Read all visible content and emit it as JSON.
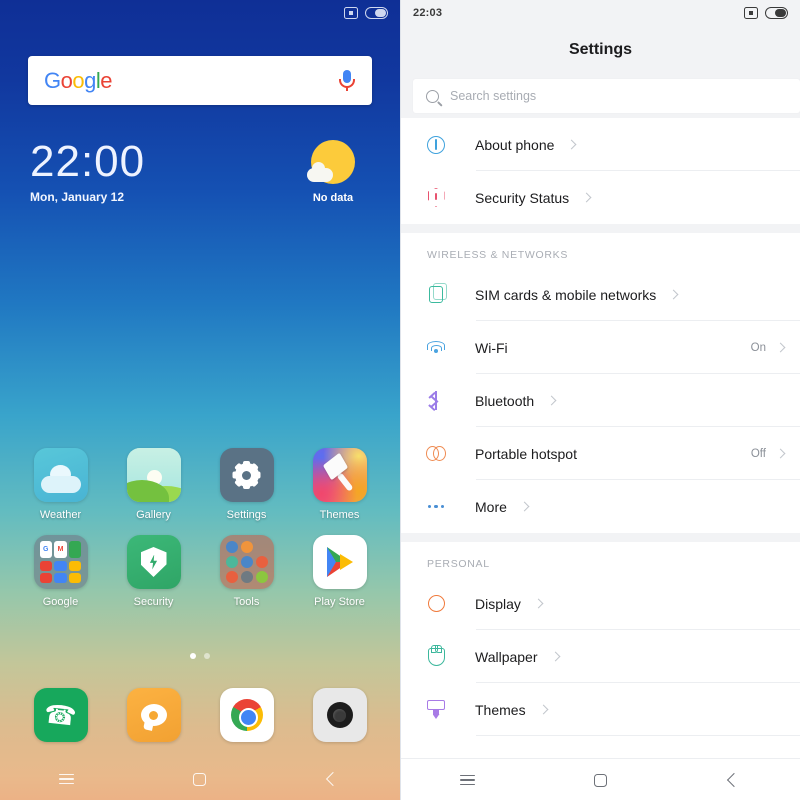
{
  "home": {
    "status_bar": {
      "icons": [
        "screenshot-icon",
        "battery-icon"
      ]
    },
    "google_search": {
      "logo_letters": [
        "G",
        "o",
        "o",
        "g",
        "l",
        "e"
      ],
      "mic_icon": "microphone-icon"
    },
    "clock_widget": {
      "time": "22:00",
      "date": "Mon, January 12"
    },
    "weather_widget": {
      "icon": "sun-cloud-icon",
      "label": "No data"
    },
    "apps": [
      {
        "label": "Weather",
        "icon": "weather-app-icon"
      },
      {
        "label": "Gallery",
        "icon": "gallery-app-icon"
      },
      {
        "label": "Settings",
        "icon": "settings-app-icon"
      },
      {
        "label": "Themes",
        "icon": "themes-app-icon"
      },
      {
        "label": "Google",
        "icon": "google-folder-icon"
      },
      {
        "label": "Security",
        "icon": "security-app-icon"
      },
      {
        "label": "Tools",
        "icon": "tools-folder-icon"
      },
      {
        "label": "Play Store",
        "icon": "play-store-app-icon"
      }
    ],
    "page_indicator": {
      "total": 2,
      "active": 1
    },
    "dock": [
      {
        "label": "Phone",
        "icon": "phone-icon"
      },
      {
        "label": "Messages",
        "icon": "message-bubble-icon"
      },
      {
        "label": "Chrome",
        "icon": "chrome-icon"
      },
      {
        "label": "Camera",
        "icon": "camera-icon"
      }
    ],
    "nav": [
      {
        "label": "Menu",
        "icon": "menu-icon"
      },
      {
        "label": "Home",
        "icon": "home-square-icon"
      },
      {
        "label": "Back",
        "icon": "back-chevron-icon"
      }
    ]
  },
  "settings": {
    "status_bar": {
      "time": "22:03",
      "icons": [
        "screenshot-icon",
        "battery-icon"
      ]
    },
    "title": "Settings",
    "search": {
      "placeholder": "Search settings",
      "value": "",
      "icon": "search-icon"
    },
    "sections": [
      {
        "label": "",
        "rows": [
          {
            "label": "About phone",
            "value": "",
            "icon": "info-icon"
          },
          {
            "label": "Security Status",
            "value": "",
            "icon": "shield-icon"
          }
        ]
      },
      {
        "label": "WIRELESS & NETWORKS",
        "rows": [
          {
            "label": "SIM cards & mobile networks",
            "value": "",
            "icon": "sim-card-icon"
          },
          {
            "label": "Wi-Fi",
            "value": "On",
            "icon": "wifi-icon"
          },
          {
            "label": "Bluetooth",
            "value": "",
            "icon": "bluetooth-icon"
          },
          {
            "label": "Portable hotspot",
            "value": "Off",
            "icon": "hotspot-icon"
          },
          {
            "label": "More",
            "value": "",
            "icon": "more-dots-icon"
          }
        ]
      },
      {
        "label": "PERSONAL",
        "rows": [
          {
            "label": "Display",
            "value": "",
            "icon": "display-icon"
          },
          {
            "label": "Wallpaper",
            "value": "",
            "icon": "wallpaper-icon"
          },
          {
            "label": "Themes",
            "value": "",
            "icon": "themes-brush-icon"
          }
        ]
      }
    ],
    "nav": [
      {
        "label": "Menu",
        "icon": "menu-icon"
      },
      {
        "label": "Home",
        "icon": "home-square-icon"
      },
      {
        "label": "Back",
        "icon": "back-chevron-icon"
      }
    ]
  },
  "colors": {
    "wallpaper_top": "#0f2f96",
    "wallpaper_mid": "#39a4cb",
    "wallpaper_bottom": "#ecb286",
    "settings_bg": "#f2f3f5",
    "row_text": "#1c1c1e",
    "section_label": "#a9adb4",
    "value_text": "#8b9098",
    "info_icon": "#3fa2dd",
    "shield_icon": "#e8536f",
    "sim_icon": "#3cba9e",
    "wifi_icon": "#4aa3e0",
    "bluetooth_icon": "#9b7ce8",
    "hotspot_icon": "#ef8b52",
    "more_icon": "#4a8fd4",
    "display_icon": "#f07a3c",
    "wallpaper_icon": "#3cb79c",
    "themes_icon": "#a87be6"
  }
}
